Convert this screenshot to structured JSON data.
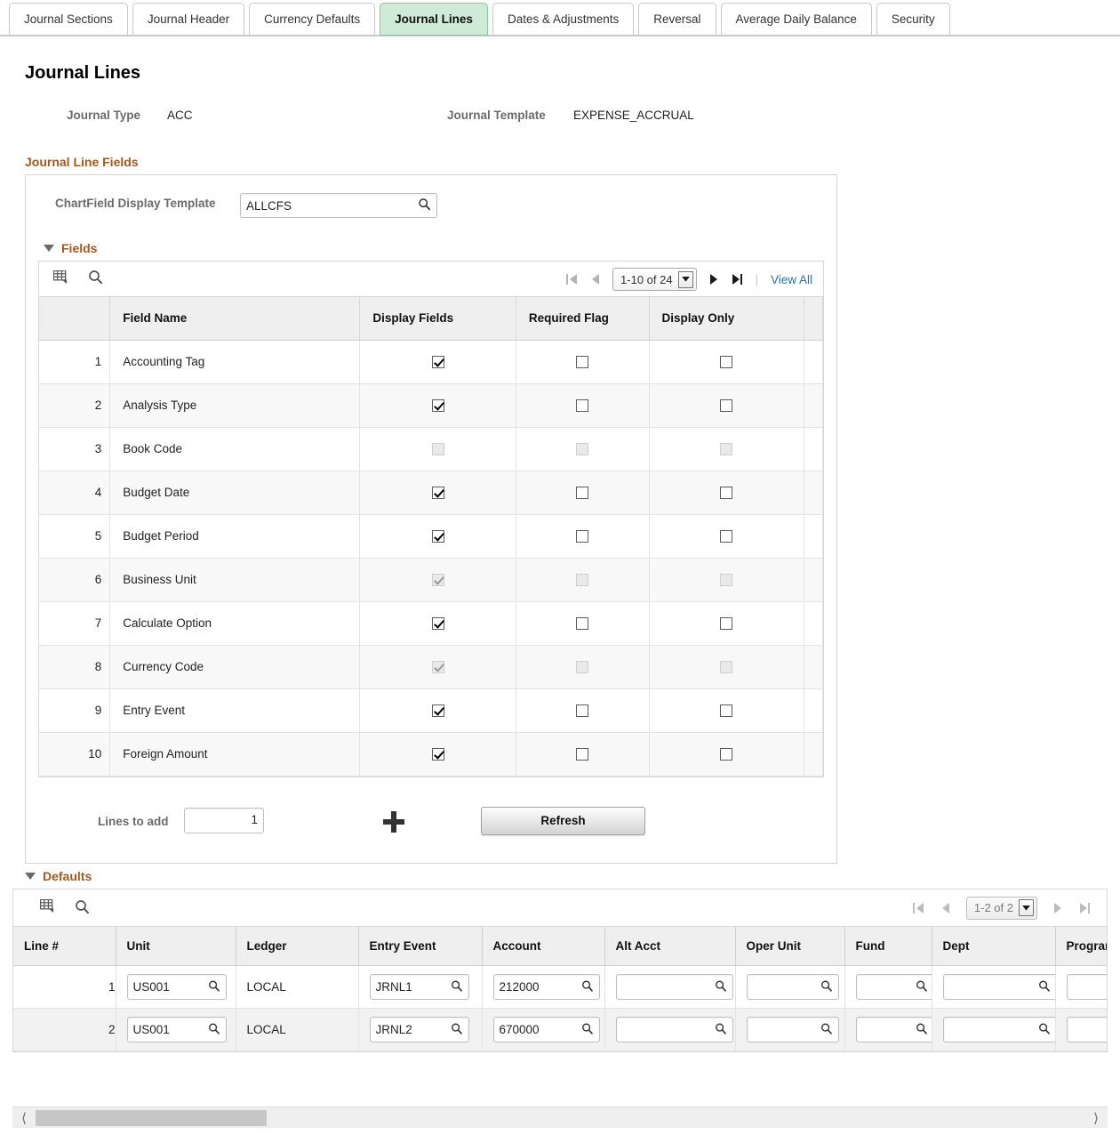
{
  "tabs": [
    {
      "label": "Journal Sections",
      "active": false
    },
    {
      "label": "Journal Header",
      "active": false
    },
    {
      "label": "Currency Defaults",
      "active": false
    },
    {
      "label": "Journal Lines",
      "active": true
    },
    {
      "label": "Dates & Adjustments",
      "active": false
    },
    {
      "label": "Reversal",
      "active": false
    },
    {
      "label": "Average Daily Balance",
      "active": false
    },
    {
      "label": "Security",
      "active": false
    }
  ],
  "page": {
    "title": "Journal Lines",
    "journal_type_label": "Journal Type",
    "journal_type_value": "ACC",
    "journal_template_label": "Journal Template",
    "journal_template_value": "EXPENSE_ACCRUAL"
  },
  "journal_line_fields": {
    "section_title": "Journal Line Fields",
    "chartfield_label": "ChartField Display Template",
    "chartfield_value": "ALLCFS",
    "chartfield_placeholder": ""
  },
  "fields_grid": {
    "section_title": "Fields",
    "personalize_icon": "grid-personalize-icon",
    "find_icon": "search-icon",
    "first_icon": "first-page-icon",
    "prev_icon": "previous-page-icon",
    "next_icon": "next-page-icon",
    "last_icon": "last-page-icon",
    "page_range": "1-10 of 24",
    "view_all_label": "View All",
    "columns": [
      "Field Name",
      "Display Fields",
      "Required Flag",
      "Display Only"
    ],
    "rows": [
      {
        "n": "1",
        "name": "Accounting Tag",
        "display": {
          "checked": true,
          "disabled": false
        },
        "required": {
          "checked": false,
          "disabled": false
        },
        "display_only": {
          "checked": false,
          "disabled": false
        }
      },
      {
        "n": "2",
        "name": "Analysis Type",
        "display": {
          "checked": true,
          "disabled": false
        },
        "required": {
          "checked": false,
          "disabled": false
        },
        "display_only": {
          "checked": false,
          "disabled": false
        }
      },
      {
        "n": "3",
        "name": "Book Code",
        "display": {
          "checked": false,
          "disabled": true
        },
        "required": {
          "checked": false,
          "disabled": true
        },
        "display_only": {
          "checked": false,
          "disabled": true
        }
      },
      {
        "n": "4",
        "name": "Budget Date",
        "display": {
          "checked": true,
          "disabled": false
        },
        "required": {
          "checked": false,
          "disabled": false
        },
        "display_only": {
          "checked": false,
          "disabled": false
        }
      },
      {
        "n": "5",
        "name": "Budget Period",
        "display": {
          "checked": true,
          "disabled": false
        },
        "required": {
          "checked": false,
          "disabled": false
        },
        "display_only": {
          "checked": false,
          "disabled": false
        }
      },
      {
        "n": "6",
        "name": "Business Unit",
        "display": {
          "checked": true,
          "disabled": true
        },
        "required": {
          "checked": false,
          "disabled": true
        },
        "display_only": {
          "checked": false,
          "disabled": true
        }
      },
      {
        "n": "7",
        "name": "Calculate Option",
        "display": {
          "checked": true,
          "disabled": false
        },
        "required": {
          "checked": false,
          "disabled": false
        },
        "display_only": {
          "checked": false,
          "disabled": false
        }
      },
      {
        "n": "8",
        "name": "Currency Code",
        "display": {
          "checked": true,
          "disabled": true
        },
        "required": {
          "checked": false,
          "disabled": true
        },
        "display_only": {
          "checked": false,
          "disabled": true
        }
      },
      {
        "n": "9",
        "name": "Entry Event",
        "display": {
          "checked": true,
          "disabled": false
        },
        "required": {
          "checked": false,
          "disabled": false
        },
        "display_only": {
          "checked": false,
          "disabled": false
        }
      },
      {
        "n": "10",
        "name": "Foreign Amount",
        "display": {
          "checked": true,
          "disabled": false
        },
        "required": {
          "checked": false,
          "disabled": false
        },
        "display_only": {
          "checked": false,
          "disabled": false
        }
      }
    ]
  },
  "add_lines": {
    "label": "Lines to add",
    "value": "1",
    "add_icon": "plus-icon",
    "refresh_label": "Refresh"
  },
  "defaults_grid": {
    "section_title": "Defaults",
    "personalize_icon": "grid-personalize-icon",
    "find_icon": "search-icon",
    "first_icon": "first-page-icon",
    "prev_icon": "previous-page-icon",
    "next_icon": "next-page-icon",
    "last_icon": "last-page-icon",
    "page_range": "1-2 of 2",
    "columns": [
      "Line #",
      "Unit",
      "Ledger",
      "Entry Event",
      "Account",
      "Alt Acct",
      "Oper Unit",
      "Fund",
      "Dept",
      "Program"
    ],
    "rows": [
      {
        "line": "1",
        "unit": "US001",
        "ledger": "LOCAL",
        "entry_event": "JRNL1",
        "account": "212000",
        "alt_acct": "",
        "oper_unit": "",
        "fund": "",
        "dept": "",
        "program": ""
      },
      {
        "line": "2",
        "unit": "US001",
        "ledger": "LOCAL",
        "entry_event": "JRNL2",
        "account": "670000",
        "alt_acct": "",
        "oper_unit": "",
        "fund": "",
        "dept": "",
        "program": ""
      }
    ]
  },
  "hscroll": {
    "left_arrow": "scroll-left-icon",
    "right_arrow": "scroll-right-icon"
  },
  "colors": {
    "active_tab_bg": "#cdebd6",
    "active_tab_border": "#86ca9d",
    "section_heading": "#a4581e",
    "link": "#2f6fb5",
    "label_gray": "#6b6b6b"
  }
}
